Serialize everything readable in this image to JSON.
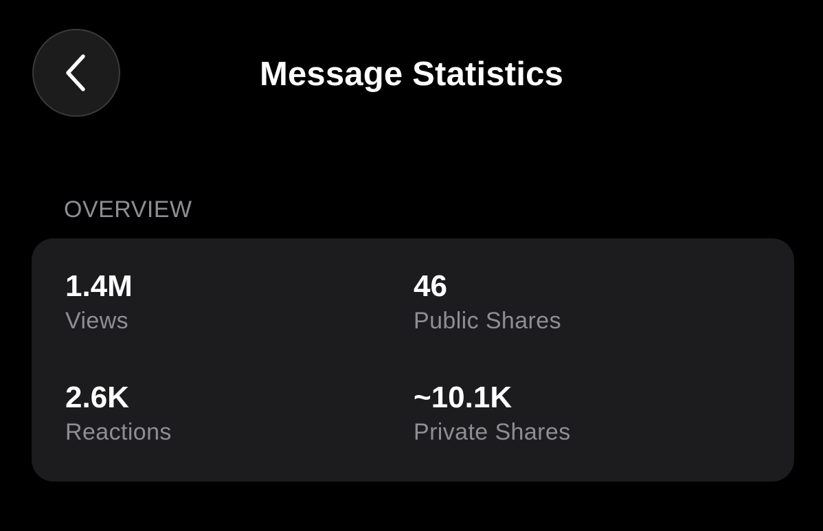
{
  "header": {
    "title": "Message Statistics",
    "back_icon": "chevron-left-icon"
  },
  "overview": {
    "section_label": "OVERVIEW",
    "stats": {
      "views": {
        "value": "1.4M",
        "label": "Views"
      },
      "public_shares": {
        "value": "46",
        "label": "Public Shares"
      },
      "reactions": {
        "value": "2.6K",
        "label": "Reactions"
      },
      "private_shares": {
        "value": "~10.1K",
        "label": "Private Shares"
      }
    }
  },
  "colors": {
    "background": "#000000",
    "card": "#1c1c1e",
    "secondary_text": "#8e8e93",
    "primary_text": "#ffffff"
  }
}
